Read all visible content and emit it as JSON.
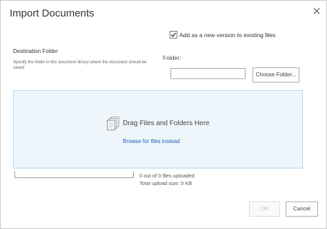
{
  "dialog": {
    "title": "Import Documents",
    "close_icon": "close-icon"
  },
  "options": {
    "add_version_label": "Add as a new version to existing files",
    "add_version_checked": true
  },
  "destination": {
    "heading": "Destination Folder",
    "description": "Specify the folder in this document library where the document should be saved.",
    "folder_label": "Folder:",
    "folder_value": "",
    "choose_folder_label": "Choose Folder..."
  },
  "dropzone": {
    "icon": "documents-icon",
    "instruction": "Drag Files and Folders Here",
    "browse_link": "Browse for files instead"
  },
  "upload_status": {
    "files_uploaded": "0 out of 0 files uploaded",
    "total_size": "Total upload size: 0 KB",
    "progress": 0
  },
  "footer": {
    "ok_label": "OK",
    "ok_enabled": false,
    "cancel_label": "Cancel"
  },
  "colors": {
    "dropzone_bg": "#eef6fc",
    "dropzone_border": "#b3d7f2",
    "link": "#1a5fb4"
  }
}
